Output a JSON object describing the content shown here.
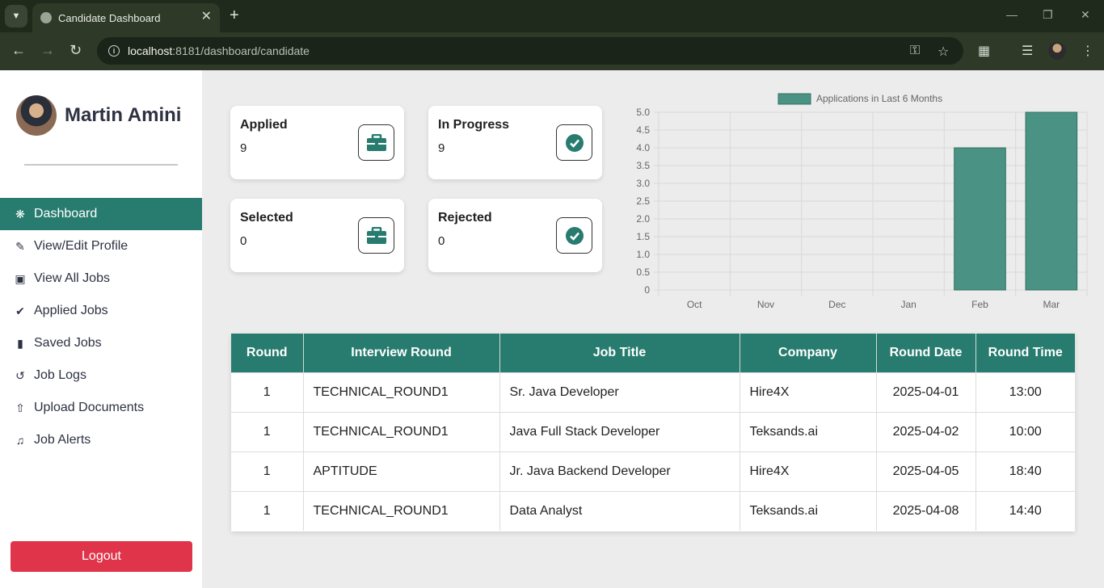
{
  "browser": {
    "tab_title": "Candidate Dashboard",
    "url_host": "localhost",
    "url_rest": ":8181/dashboard/candidate"
  },
  "sidebar": {
    "user_name": "Martin Amini",
    "items": [
      {
        "label": "Dashboard",
        "icon": "palette-icon",
        "active": true
      },
      {
        "label": "View/Edit Profile",
        "icon": "user-edit-icon",
        "active": false
      },
      {
        "label": "View All Jobs",
        "icon": "briefcase-icon",
        "active": false
      },
      {
        "label": "Applied Jobs",
        "icon": "check-circle-icon",
        "active": false
      },
      {
        "label": "Saved Jobs",
        "icon": "bookmark-icon",
        "active": false
      },
      {
        "label": "Job Logs",
        "icon": "history-icon",
        "active": false
      },
      {
        "label": "Upload Documents",
        "icon": "file-upload-icon",
        "active": false
      },
      {
        "label": "Job Alerts",
        "icon": "bell-icon",
        "active": false
      }
    ],
    "logout_label": "Logout"
  },
  "stats": [
    {
      "label": "Applied",
      "value": "9",
      "icon": "briefcase-icon"
    },
    {
      "label": "In Progress",
      "value": "9",
      "icon": "check-circle-icon"
    },
    {
      "label": "Selected",
      "value": "0",
      "icon": "briefcase-icon"
    },
    {
      "label": "Rejected",
      "value": "0",
      "icon": "check-circle-icon"
    }
  ],
  "chart_data": {
    "type": "bar",
    "categories": [
      "Oct",
      "Nov",
      "Dec",
      "Jan",
      "Feb",
      "Mar"
    ],
    "series": [
      {
        "name": "Applications in Last 6 Months",
        "values": [
          0,
          0,
          0,
          0,
          4,
          5
        ]
      }
    ],
    "ylim": [
      0,
      5
    ],
    "yticks": [
      "0",
      "0.5",
      "1.0",
      "1.5",
      "2.0",
      "2.5",
      "3.0",
      "3.5",
      "4.0",
      "4.5",
      "5.0"
    ],
    "grid": true,
    "legend": "top",
    "color": "#4a9384"
  },
  "table": {
    "headers": [
      "Round",
      "Interview Round",
      "Job Title",
      "Company",
      "Round Date",
      "Round Time"
    ],
    "rows": [
      [
        "1",
        "TECHNICAL_ROUND1",
        "Sr. Java Developer",
        "Hire4X",
        "2025-04-01",
        "13:00"
      ],
      [
        "1",
        "TECHNICAL_ROUND1",
        "Java Full Stack Developer",
        "Teksands.ai",
        "2025-04-02",
        "10:00"
      ],
      [
        "1",
        "APTITUDE",
        "Jr. Java Backend Developer",
        "Hire4X",
        "2025-04-05",
        "18:40"
      ],
      [
        "1",
        "TECHNICAL_ROUND1",
        "Data Analyst",
        "Teksands.ai",
        "2025-04-08",
        "14:40"
      ]
    ]
  },
  "colors": {
    "accent": "#277c6f",
    "danger": "#e0344a"
  }
}
